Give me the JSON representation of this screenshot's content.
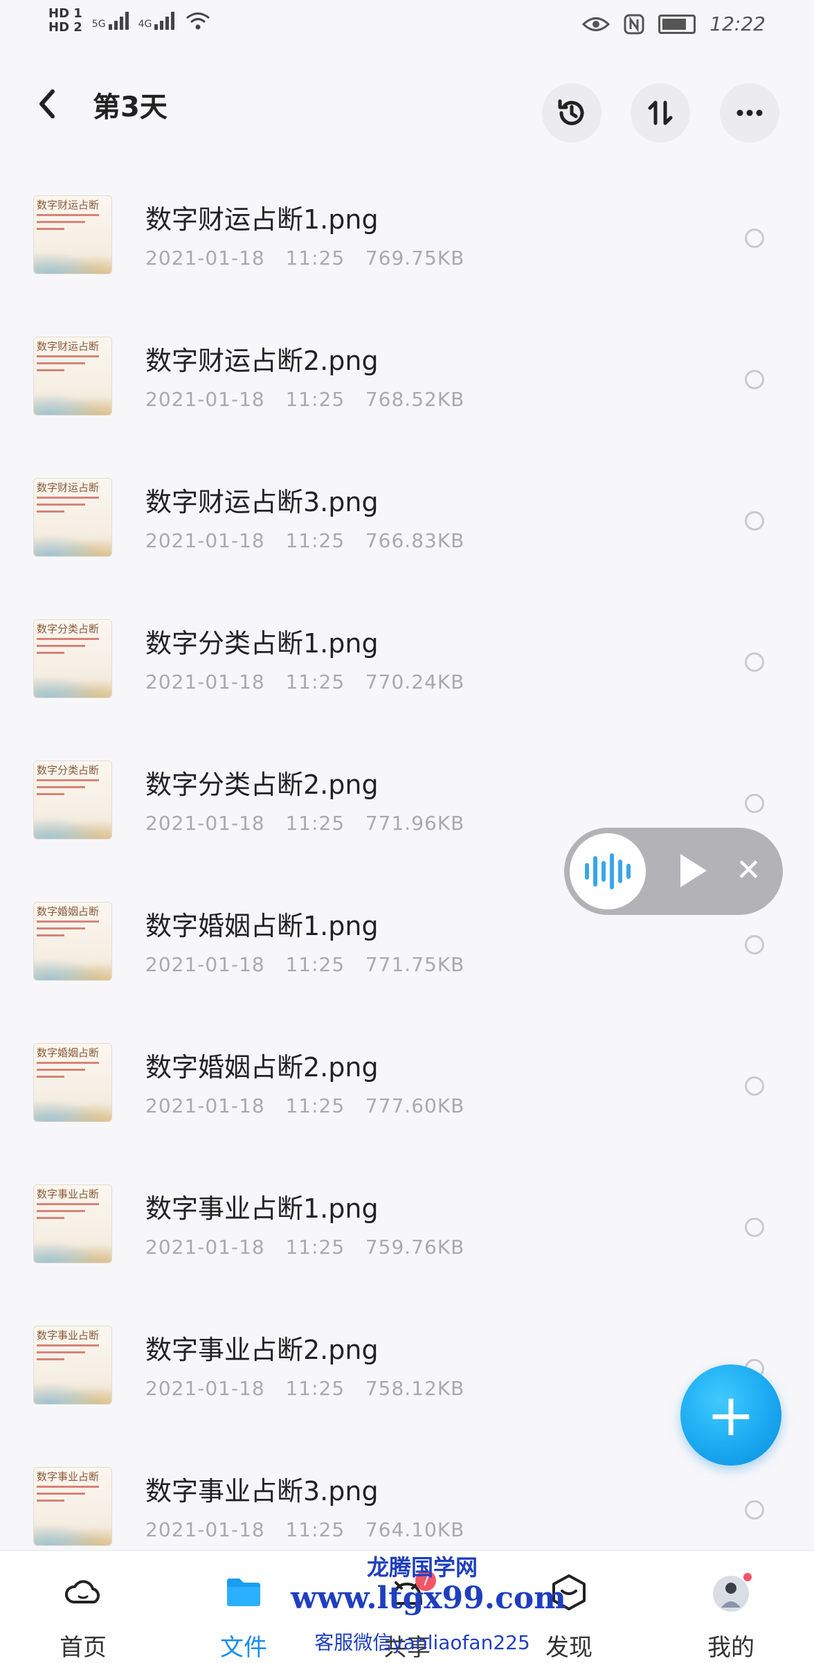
{
  "status_bar": {
    "hd1": "HD 1",
    "hd2": "HD 2",
    "net1": "5G",
    "net2": "4G",
    "time": "12:22"
  },
  "header": {
    "title": "第3天"
  },
  "files": [
    {
      "thumb_title": "数字财运占断",
      "name": "数字财运占断1.png",
      "date": "2021-01-18",
      "time": "11:25",
      "size": "769.75KB"
    },
    {
      "thumb_title": "数字财运占断",
      "name": "数字财运占断2.png",
      "date": "2021-01-18",
      "time": "11:25",
      "size": "768.52KB"
    },
    {
      "thumb_title": "数字财运占断",
      "name": "数字财运占断3.png",
      "date": "2021-01-18",
      "time": "11:25",
      "size": "766.83KB"
    },
    {
      "thumb_title": "数字分类占断",
      "name": "数字分类占断1.png",
      "date": "2021-01-18",
      "time": "11:25",
      "size": "770.24KB"
    },
    {
      "thumb_title": "数字分类占断",
      "name": "数字分类占断2.png",
      "date": "2021-01-18",
      "time": "11:25",
      "size": "771.96KB"
    },
    {
      "thumb_title": "数字婚姻占断",
      "name": "数字婚姻占断1.png",
      "date": "2021-01-18",
      "time": "11:25",
      "size": "771.75KB"
    },
    {
      "thumb_title": "数字婚姻占断",
      "name": "数字婚姻占断2.png",
      "date": "2021-01-18",
      "time": "11:25",
      "size": "777.60KB"
    },
    {
      "thumb_title": "数字事业占断",
      "name": "数字事业占断1.png",
      "date": "2021-01-18",
      "time": "11:25",
      "size": "759.76KB"
    },
    {
      "thumb_title": "数字事业占断",
      "name": "数字事业占断2.png",
      "date": "2021-01-18",
      "time": "11:25",
      "size": "758.12KB"
    },
    {
      "thumb_title": "数字事业占断",
      "name": "数字事业占断3.png",
      "date": "2021-01-18",
      "time": "11:25",
      "size": "764.10KB"
    }
  ],
  "nav": {
    "tabs": [
      {
        "label": "首页",
        "icon": "cloud-icon"
      },
      {
        "label": "文件",
        "icon": "folder-icon",
        "active": true
      },
      {
        "label": "共享",
        "icon": "share-icon",
        "badge": "7"
      },
      {
        "label": "发现",
        "icon": "discover-icon"
      },
      {
        "label": "我的",
        "icon": "avatar-icon"
      }
    ]
  },
  "watermark": {
    "line1": "龙腾国学网",
    "line2": "www.ltgx99.com",
    "line3": "客服微信yanliaofan225"
  },
  "colors": {
    "accent": "#1a8de8",
    "fab": "#18a6ef",
    "badge": "#f25566"
  }
}
